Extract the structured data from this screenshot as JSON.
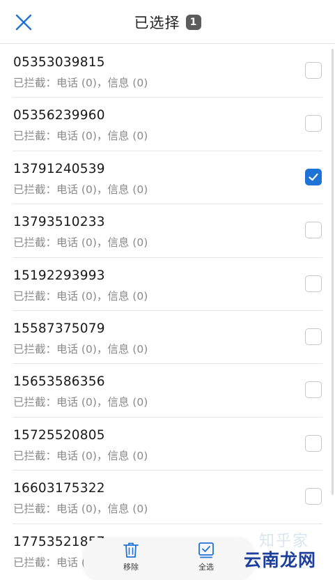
{
  "header": {
    "title": "已选择",
    "selected_count": "1"
  },
  "contacts": [
    {
      "number": "05353039815",
      "status": "已拦截：电话 (0)，信息 (0)",
      "checked": false
    },
    {
      "number": "05356239960",
      "status": "已拦截：电话 (0)，信息 (0)",
      "checked": false
    },
    {
      "number": "13791240539",
      "status": "已拦截：电话 (0)，信息 (0)",
      "checked": true
    },
    {
      "number": "13793510233",
      "status": "已拦截：电话 (0)，信息 (0)",
      "checked": false
    },
    {
      "number": "15192293993",
      "status": "已拦截：电话 (0)，信息 (0)",
      "checked": false
    },
    {
      "number": "15587375079",
      "status": "已拦截：电话 (0)，信息 (0)",
      "checked": false
    },
    {
      "number": "15653586356",
      "status": "已拦截：电话 (0)，信息 (0)",
      "checked": false
    },
    {
      "number": "15725520805",
      "status": "已拦截：电话 (0)，信息 (0)",
      "checked": false
    },
    {
      "number": "16603175322",
      "status": "已拦截：电话 (0)，信息 (0)",
      "checked": false
    },
    {
      "number": "17753521857",
      "status": "已拦截：电话 (0)，信息 (0)",
      "checked": false
    }
  ],
  "bottom_bar": {
    "remove_label": "移除",
    "select_all_label": "全选"
  },
  "watermark": {
    "top_text": "知乎家",
    "bottom_text": "云南龙网"
  },
  "colors": {
    "accent": "#1f72d6",
    "badge_bg": "#5c5c5c",
    "secondary_text": "#8a8a8a"
  },
  "icons": {
    "close": "close-icon",
    "remove": "trash-icon",
    "select_all": "select-all-icon",
    "check": "check-icon"
  }
}
